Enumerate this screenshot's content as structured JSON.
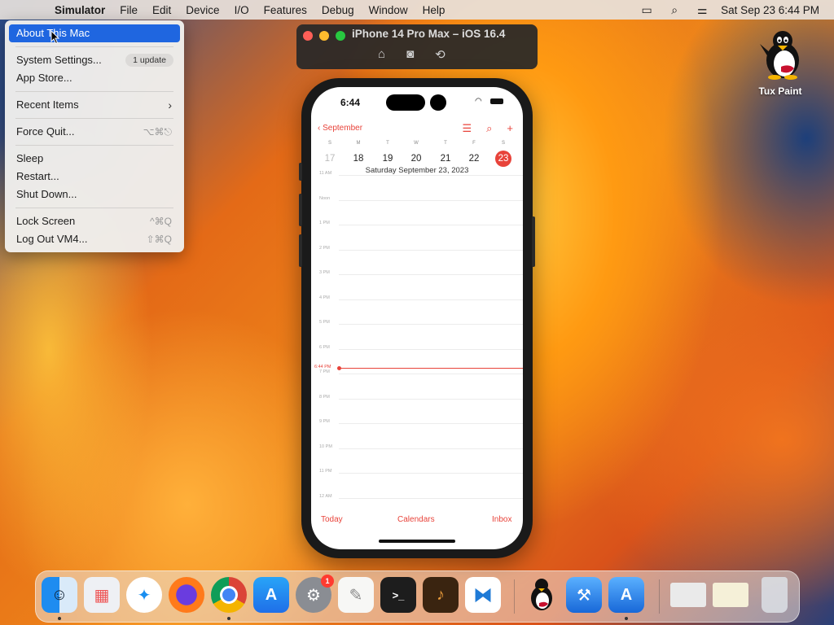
{
  "menubar": {
    "app": "Simulator",
    "menus": [
      "File",
      "Edit",
      "Device",
      "I/O",
      "Features",
      "Debug",
      "Window",
      "Help"
    ],
    "clock": "Sat Sep 23  6:44 PM"
  },
  "apple_menu": {
    "about": "About This Mac",
    "system_settings": "System Settings...",
    "update_badge": "1 update",
    "app_store": "App Store...",
    "recent_items": "Recent Items",
    "force_quit": "Force Quit...",
    "force_quit_shortcut": "⌥⌘⎋",
    "sleep": "Sleep",
    "restart": "Restart...",
    "shut_down": "Shut Down...",
    "lock_screen": "Lock Screen",
    "lock_shortcut": "^⌘Q",
    "log_out": "Log Out VM4...",
    "log_out_shortcut": "⇧⌘Q"
  },
  "simulator": {
    "title": "iPhone 14 Pro Max – iOS 16.4"
  },
  "phone": {
    "time": "6:44",
    "calendar": {
      "back_label": "September",
      "weekdays": [
        "S",
        "M",
        "T",
        "W",
        "T",
        "F",
        "S"
      ],
      "days": [
        "17",
        "18",
        "19",
        "20",
        "21",
        "22",
        "23"
      ],
      "selected_date": "Saturday  September 23, 2023",
      "hours": [
        "11 AM",
        "Noon",
        "1 PM",
        "2 PM",
        "3 PM",
        "4 PM",
        "5 PM",
        "6 PM",
        "7 PM",
        "8 PM",
        "9 PM",
        "10 PM",
        "11 PM",
        "12 AM"
      ],
      "now_label": "6:44 PM",
      "tabs": {
        "today": "Today",
        "calendars": "Calendars",
        "inbox": "Inbox"
      }
    }
  },
  "desktop": {
    "icon_label": "Tux Paint"
  },
  "dock": {
    "apps": [
      "Finder",
      "Launchpad",
      "Safari",
      "Firefox",
      "Chrome",
      "App Store",
      "System Settings",
      "TextEdit",
      "Terminal",
      "GarageBand",
      "VS Code",
      "Tux Paint",
      "Xcode",
      "Simulator"
    ],
    "settings_badge": "1"
  },
  "colors": {
    "accent": "#1f66e0",
    "calendar_red": "#e8433a"
  }
}
